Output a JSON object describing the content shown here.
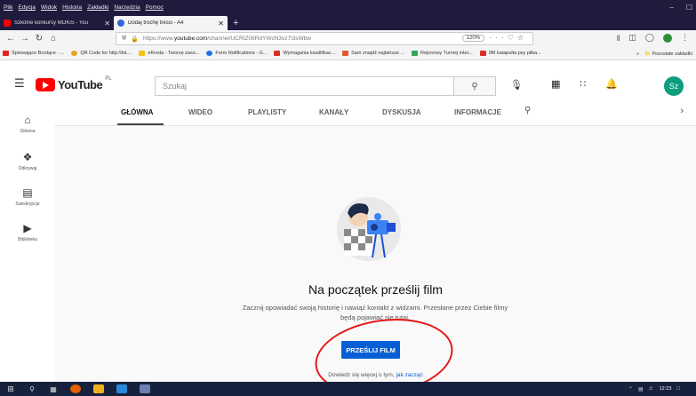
{
  "browser": {
    "menu": [
      "Plik",
      "Edycja",
      "Widok",
      "Historia",
      "Zakładki",
      "Narzędzia",
      "Pomoc"
    ],
    "window_controls": {
      "minimize": "–",
      "maximize": "☐"
    },
    "tabs": [
      {
        "title": "Szkolne konkursy MOKiS - You",
        "close": "✕",
        "color": "#ff0000"
      },
      {
        "title": "Dodaj trochę treści - A4",
        "close": "✕",
        "color": "#3367d6"
      }
    ],
    "new_tab": "+",
    "url_prefix": "https://www.",
    "url_host": "youtube.com",
    "url_path": "/channel/UCRIZ06RdYWcN3vz7l3sWbw",
    "zoom": "120%",
    "url_more": "···",
    "bookmarks": [
      {
        "label": "Śpiewające Brzdące - ...",
        "color": "#e02424"
      },
      {
        "label": "QR Code for http://bit....",
        "color": "#e8a317"
      },
      {
        "label": "eKreda - Tworzę zaso...",
        "color": "#f2c318"
      },
      {
        "label": "Form Notifications - G...",
        "color": "#1a73e8"
      },
      {
        "label": "Wymagania kwalifikac...",
        "color": "#d93025"
      },
      {
        "label": "Sam znajdź najtańsze ...",
        "color": "#e05a2b"
      },
      {
        "label": "Rejonowy Turniej inter...",
        "color": "#34a853"
      },
      {
        "label": "9M katapulta psy piłka...",
        "color": "#d93025"
      }
    ],
    "bookmarks_more": "»",
    "bookmarks_other": "Pozostałe zakładki"
  },
  "youtube": {
    "logo_text": "YouTube",
    "logo_country": "PL",
    "search_placeholder": "Szukaj",
    "avatar_initials": "Sz",
    "sidebar": [
      {
        "label": "Główna",
        "icon": "home-icon"
      },
      {
        "label": "Odkrywaj",
        "icon": "explore-icon"
      },
      {
        "label": "Subskrypcje",
        "icon": "subscriptions-icon"
      },
      {
        "label": "Biblioteka",
        "icon": "library-icon"
      }
    ],
    "channel_tabs": [
      "GŁÓWNA",
      "WIDEO",
      "PLAYLISTY",
      "KANAŁY",
      "DYSKUSJA",
      "INFORMACJE"
    ],
    "active_tab": "GŁÓWNA",
    "empty_state": {
      "headline": "Na początek prześlij film",
      "description": "Zacznij opowiadać swoją historię i nawiąż kontakt z widzami. Przesłane przez Ciebie filmy będą pojawiać się tutaj.",
      "upload_button": "PRZEŚLIJ FILM",
      "learn_more_text": "Dowiedz się więcej o tym,",
      "learn_more_link": "jak zacząć"
    }
  },
  "taskbar": {
    "clock_time": "12:23"
  },
  "colors": {
    "titlebar": "#1f1b3d",
    "youtube_red": "#ff0000",
    "primary_blue": "#065fd4",
    "annotation_red": "#e31a1a",
    "avatar_bg": "#0b9d7d"
  }
}
